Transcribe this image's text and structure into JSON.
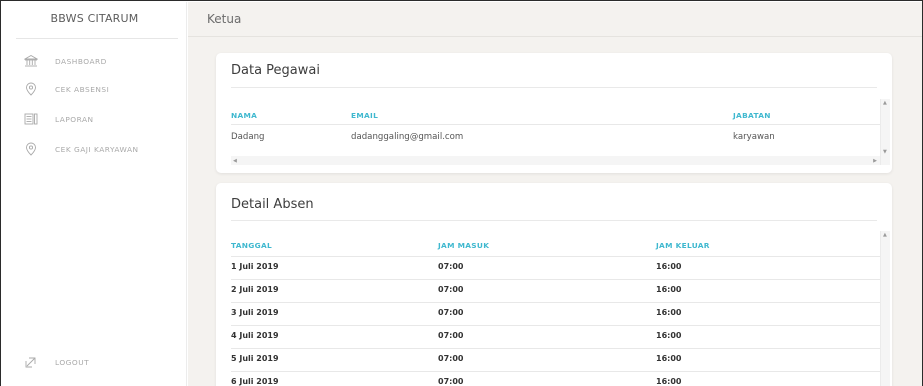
{
  "sidebar": {
    "brand": "BBWS CITARUM",
    "items": [
      {
        "label": "DASHBOARD",
        "icon": "bank-icon"
      },
      {
        "label": "CEK ABSENSI",
        "icon": "location-pin-icon"
      },
      {
        "label": "LAPORAN",
        "icon": "report-icon"
      },
      {
        "label": "CEK GAJI KARYAWAN",
        "icon": "location-pin-icon"
      }
    ],
    "logout": {
      "label": "LOGOUT",
      "icon": "logout-icon"
    }
  },
  "header": {
    "title": "Ketua"
  },
  "pegawai": {
    "title": "Data Pegawai",
    "columns": [
      "NAMA",
      "EMAIL",
      "JABATAN"
    ],
    "rows": [
      {
        "nama": "Dadang",
        "email": "dadanggaling@gmail.com",
        "jabatan": "karyawan"
      }
    ]
  },
  "absen": {
    "title": "Detail Absen",
    "columns": [
      "TANGGAL",
      "JAM MASUK",
      "JAM KELUAR"
    ],
    "rows": [
      {
        "tanggal": "1 Juli 2019",
        "masuk": "07:00",
        "keluar": "16:00"
      },
      {
        "tanggal": "2 Juli 2019",
        "masuk": "07:00",
        "keluar": "16:00"
      },
      {
        "tanggal": "3 Juli 2019",
        "masuk": "07:00",
        "keluar": "16:00"
      },
      {
        "tanggal": "4 Juli 2019",
        "masuk": "07:00",
        "keluar": "16:00"
      },
      {
        "tanggal": "5 Juli 2019",
        "masuk": "07:00",
        "keluar": "16:00"
      },
      {
        "tanggal": "6 Juli 2019",
        "masuk": "07:00",
        "keluar": "16:00"
      }
    ]
  },
  "colors": {
    "accent": "#3fb8cf",
    "background": "#f4f2ef",
    "sidebar_text": "#a9a9a9"
  }
}
